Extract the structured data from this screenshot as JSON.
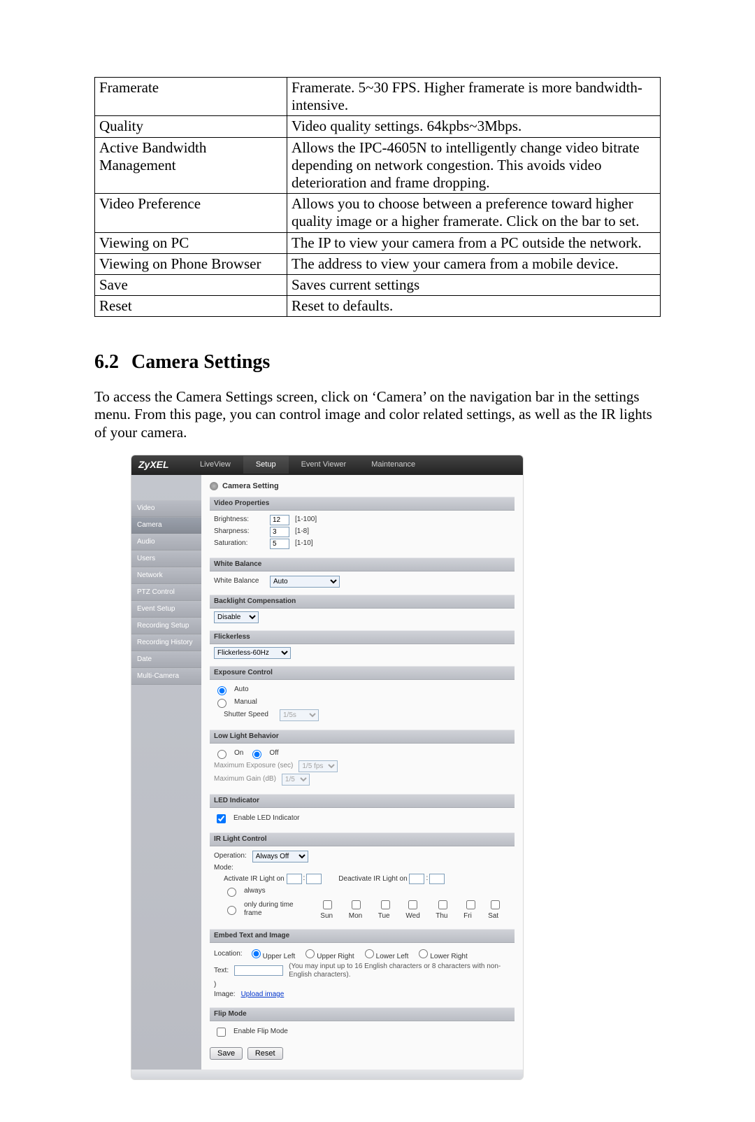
{
  "spec_table": [
    {
      "k": "Framerate",
      "v": "Framerate. 5~30 FPS. Higher framerate is more bandwidth-intensive."
    },
    {
      "k": "Quality",
      "v": "Video quality settings. 64kpbs~3Mbps."
    },
    {
      "k": "Active Bandwidth Management",
      "v": "Allows the IPC-4605N to intelligently change video bitrate depending on network congestion. This avoids video deterioration and frame dropping."
    },
    {
      "k": "Video Preference",
      "v": "Allows you to choose between a preference toward higher quality image or a higher framerate. Click on the bar to set."
    },
    {
      "k": "Viewing on PC",
      "v": "The IP to view your camera from a PC outside the network."
    },
    {
      "k": "Viewing on Phone Browser",
      "v": "The address to view your camera from a mobile device."
    },
    {
      "k": "Save",
      "v": "Saves current settings"
    },
    {
      "k": "Reset",
      "v": "Reset to defaults."
    }
  ],
  "section": {
    "num": "6.2",
    "title": "Camera Settings"
  },
  "paragraph": "To access the Camera Settings screen, click on ‘Camera’ on the navigation bar in the settings menu. From this page, you can control image and color related settings, as well as the IR lights of your camera.",
  "ui": {
    "brand": "ZyXEL",
    "tabs": [
      "LiveView",
      "Setup",
      "Event Viewer",
      "Maintenance"
    ],
    "active_tab": 1,
    "side_items": [
      "Video",
      "Camera",
      "Audio",
      "Users",
      "Network",
      "PTZ Control",
      "Event Setup",
      "Recording Setup",
      "Recording History",
      "Date",
      "Multi-Camera"
    ],
    "active_side": 1,
    "panel_title": "Camera Setting",
    "video_props": {
      "title": "Video Properties",
      "brightness": {
        "label": "Brightness:",
        "value": "12",
        "hint": "[1-100]"
      },
      "sharpness": {
        "label": "Sharpness:",
        "value": "3",
        "hint": "[1-8]"
      },
      "saturation": {
        "label": "Saturation:",
        "value": "5",
        "hint": "[1-10]"
      }
    },
    "white_balance": {
      "title": "White Balance",
      "label": "White Balance",
      "value": "Auto"
    },
    "backlight": {
      "title": "Backlight Compensation",
      "value": "Disable"
    },
    "flicker": {
      "title": "Flickerless",
      "value": "Flickerless-60Hz"
    },
    "exposure": {
      "title": "Exposure Control",
      "auto": "Auto",
      "manual": "Manual",
      "shutter_label": "Shutter Speed",
      "shutter_value": "1/5s"
    },
    "lowlight": {
      "title": "Low Light Behavior",
      "on": "On",
      "off": "Off",
      "max_exp_label": "Maximum Exposure (sec)",
      "max_exp_value": "1/5 fps",
      "max_gain_label": "Maximum Gain (dB)",
      "max_gain_value": "1/5"
    },
    "led": {
      "title": "LED Indicator",
      "label": "Enable LED Indicator"
    },
    "ir": {
      "title": "IR Light Control",
      "op_label": "Operation:",
      "op_value": "Always Off",
      "mode_label": "Mode:",
      "activate_label": "Activate IR Light on",
      "deactivate_label": "Deactivate IR Light on",
      "always": "always",
      "only_label": "only during time frame",
      "days": [
        "Sun",
        "Mon",
        "Tue",
        "Wed",
        "Thu",
        "Fri",
        "Sat"
      ]
    },
    "embed": {
      "title": "Embed Text and Image",
      "loc_label": "Location:",
      "loc_options": [
        "Upper Left",
        "Upper Right",
        "Lower Left",
        "Lower Right"
      ],
      "text_label": "Text:",
      "text_hint": "(You may input up to 16 English characters or 8 characters with non-English characters).",
      "paren": ")",
      "image_label": "Image:",
      "image_link": "Upload image"
    },
    "flip": {
      "title": "Flip Mode",
      "label": "Enable Flip Mode"
    },
    "save": "Save",
    "reset": "Reset"
  }
}
